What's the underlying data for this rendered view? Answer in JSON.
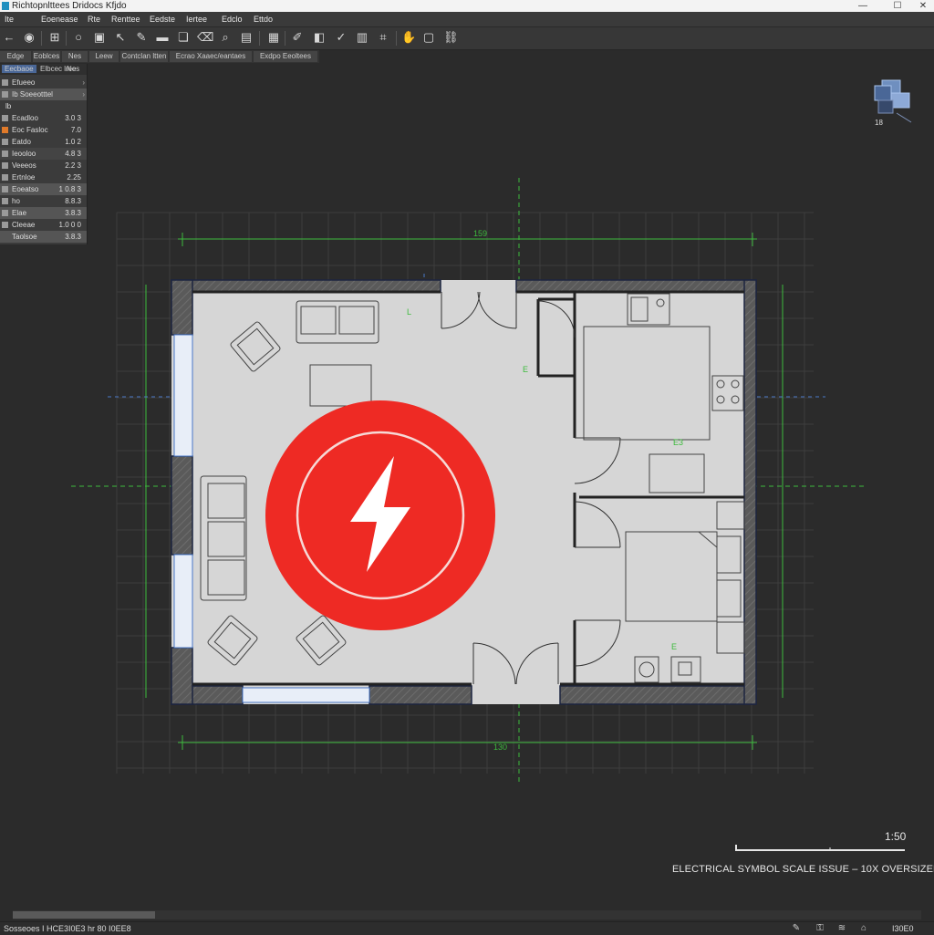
{
  "window": {
    "title": "Richtopnlttees Dridocs Kfjdo"
  },
  "menu": [
    "Ite",
    "Eoenease",
    "Rte",
    "Renttee",
    "Eedste",
    "Iertee",
    "Edclo",
    "Ettdo"
  ],
  "toolbar": {
    "items": [
      "back-icon",
      "stop-icon",
      "select-icon",
      "circle-icon",
      "frame-icon",
      "cursor-icon",
      "pen-icon",
      "ruler-icon",
      "layers-icon",
      "eraser-icon",
      "zoom-icon",
      "image-icon",
      "grid-icon",
      "brush-icon",
      "align-icon",
      "check-icon",
      "table-icon",
      "snap-icon",
      "pan-icon",
      "window-icon",
      "link-icon"
    ]
  },
  "tabs": [
    "Edge",
    "Eoblces",
    "Nes",
    "Leew",
    "Contclan ltten",
    "Ecrao Xaaec/eantaes",
    "Exdpo Eeoltees"
  ],
  "panel": {
    "header": [
      "Eecbaoe",
      "Elbcec lree",
      "Nes"
    ],
    "rows": [
      {
        "label": "Efueeo",
        "value": "",
        "chevron": "›"
      },
      {
        "label": "Ib Soeeotttel",
        "value": "",
        "chevron": "›"
      },
      {
        "label": "lb",
        "value": "",
        "chevron": ""
      },
      {
        "label": "Ecadloo",
        "value": "3.0 3",
        "chevron": ""
      },
      {
        "label": "Eoc Fasloc",
        "value": "7.0",
        "chevron": ""
      },
      {
        "label": "Eatdo",
        "value": "1.0 2",
        "chevron": ""
      },
      {
        "label": "Ieooloo",
        "value": "4.8 3",
        "chevron": ""
      },
      {
        "label": "Veeeos",
        "value": "2.2 3",
        "chevron": ""
      },
      {
        "label": "Ertnloe",
        "value": "2.25",
        "chevron": ""
      },
      {
        "label": "Eoeatso",
        "value": "1 0.8 3",
        "chevron": ""
      },
      {
        "label": "ho",
        "value": "8.8.3",
        "chevron": ""
      },
      {
        "label": "Elae",
        "value": "3.8.3",
        "chevron": ""
      },
      {
        "label": "Cleeae",
        "value": "1.0 0 0",
        "chevron": ""
      },
      {
        "label": "Taolsoe",
        "value": "3.8.3",
        "chevron": ""
      }
    ]
  },
  "drawing": {
    "dim_top": "159",
    "dim_bottom": "130",
    "room_labels": [
      "L",
      "E",
      "E3",
      "E"
    ],
    "nav_cube_label": "18"
  },
  "overlay": {
    "symbol": "electrical-bolt-icon",
    "color": "#ee2a24"
  },
  "scale": {
    "label": "1:50"
  },
  "issue": {
    "caption": "ELECTRICAL SYMBOL SCALE ISSUE – 10X OVERSIZED"
  },
  "status": {
    "text": "Sosseoes I HCE3I0E3 hr 80 I0EE8",
    "value": "I30E0",
    "icons": [
      "pencil-icon",
      "lock-icon",
      "stack-icon",
      "home-icon"
    ]
  },
  "colors": {
    "background": "#2b2b2b",
    "floor": "#d6d6d6",
    "wall": "#555555",
    "grid": "#3f3f3f",
    "dimension": "#3dbb3d",
    "construction": "#4a78c8",
    "alert": "#ee2a24"
  }
}
